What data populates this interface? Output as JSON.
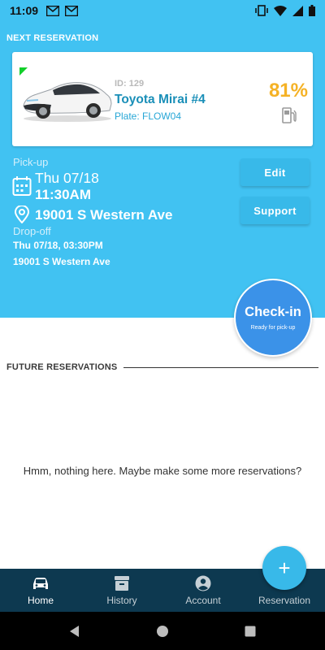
{
  "status_bar": {
    "time": "11:09",
    "left_icons": [
      "gmail-icon",
      "gmail-icon"
    ],
    "right_icons": [
      "vibrate-icon",
      "wifi-icon",
      "signal-icon",
      "battery-icon"
    ]
  },
  "next_reservation": {
    "section_label": "NEXT RESERVATION",
    "car": {
      "id_text": "ID: 129",
      "name": "Toyota Mirai #4",
      "plate": "Plate: FLOW04",
      "fuel_percent": "81%"
    },
    "pickup": {
      "label": "Pick-up",
      "date": "Thu 07/18",
      "time": "11:30AM",
      "address": "19001 S Western Ave"
    },
    "dropoff": {
      "label": "Drop-off",
      "datetime": "Thu 07/18, 03:30PM",
      "address": "19001 S Western Ave"
    },
    "buttons": {
      "edit": "Edit",
      "support": "Support"
    },
    "checkin": {
      "title": "Check-in",
      "subtitle": "Ready for pick-up"
    }
  },
  "future": {
    "section_label": "FUTURE RESERVATIONS",
    "empty_message": "Hmm, nothing here. Maybe make some more reservations?"
  },
  "fab": {
    "label": "+"
  },
  "bottom_nav": {
    "items": [
      {
        "label": "Home",
        "icon": "car-icon",
        "active": true
      },
      {
        "label": "History",
        "icon": "archive-icon",
        "active": false
      },
      {
        "label": "Account",
        "icon": "account-circle-icon",
        "active": false
      },
      {
        "label": "Reservation",
        "icon": "",
        "active": false
      }
    ]
  },
  "colors": {
    "hero_bg": "#41c2f2",
    "nav_bg": "#0d3950",
    "checkin_bg": "#3b92e8",
    "fuel": "#f5b225",
    "car_name": "#1a8fb8",
    "indicator": "#12cf2a"
  }
}
